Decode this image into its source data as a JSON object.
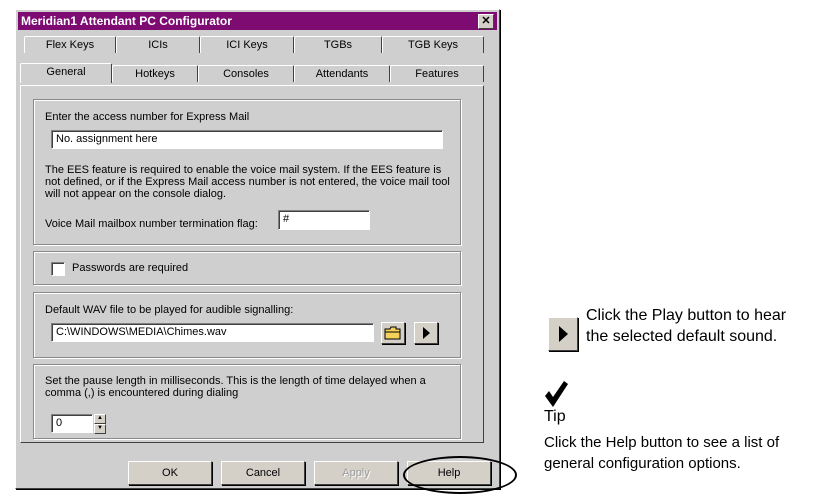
{
  "dialog": {
    "title": "Meridian1 Attendant PC Configurator",
    "close_glyph": "✕",
    "tabs_back": [
      "Flex Keys",
      "ICIs",
      "ICI Keys",
      "TGBs",
      "TGB Keys"
    ],
    "tabs_front": [
      "General",
      "Hotkeys",
      "Consoles",
      "Attendants",
      "Features"
    ],
    "active_tab": "General"
  },
  "general": {
    "express_mail_label": "Enter the access number for Express Mail",
    "express_mail_value": "No. assignment here",
    "ees_note": "The EES feature is required to enable the voice mail system. If the EES feature is not defined, or if the Express Mail access number is not entered, the voice mail tool will not appear on the console dialog.",
    "term_flag_label": "Voice Mail mailbox number termination flag:",
    "term_flag_value": "#",
    "passwords_label": "Passwords are required",
    "passwords_checked": false,
    "wav_label": "Default WAV file to be played for audible signalling:",
    "wav_value": "C:\\WINDOWS\\MEDIA\\Chimes.wav",
    "pause_label": "Set the pause length in milliseconds. This is the length of time delayed when a comma (,) is encountered during dialing",
    "pause_value": "0"
  },
  "buttons": {
    "ok": "OK",
    "cancel": "Cancel",
    "apply": "Apply",
    "help": "Help"
  },
  "side": {
    "play_text_1": "Click the Play button to hear",
    "play_text_2": "the selected default sound.",
    "tip_label": "Tip",
    "help_text_1": "Click the Help button to see a list of",
    "help_text_2": "general configuration options."
  }
}
